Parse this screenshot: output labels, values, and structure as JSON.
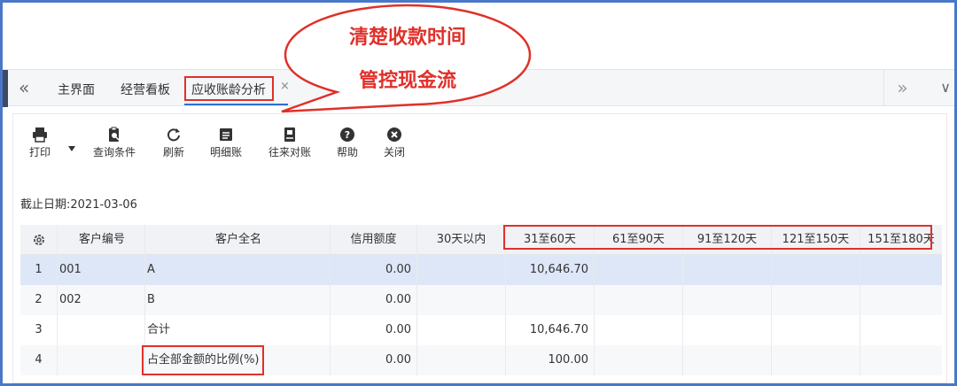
{
  "callout": {
    "line1": "清楚收款时间",
    "line2": "管控现金流"
  },
  "tabs": {
    "home": "主界面",
    "board": "经营看板",
    "active": "应收账龄分析",
    "close": "×"
  },
  "nav": {
    "back": "«",
    "forward": "»",
    "dropdown": "∨"
  },
  "toolbar": {
    "print": "打印",
    "query": "查询条件",
    "refresh": "刷新",
    "detail": "明细账",
    "reconcile": "往来对账",
    "help": "帮助",
    "close": "关闭"
  },
  "cutoff": "截止日期:2021-03-06",
  "table": {
    "headers": [
      "客户编号",
      "客户全名",
      "信用额度",
      "30天以内",
      "31至60天",
      "61至90天",
      "91至120天",
      "121至150天",
      "151至180天"
    ],
    "rows": [
      {
        "idx": "1",
        "code": "001",
        "name": "A",
        "credit": "0.00",
        "d30": "",
        "d60": "10,646.70"
      },
      {
        "idx": "2",
        "code": "002",
        "name": "B",
        "credit": "0.00",
        "d30": "",
        "d60": ""
      },
      {
        "idx": "3",
        "code": "",
        "name": "合计",
        "credit": "0.00",
        "d30": "",
        "d60": "10,646.70"
      },
      {
        "idx": "4",
        "code": "",
        "name": "占全部金额的比例(%)",
        "credit": "0.00",
        "d30": "",
        "d60": "100.00"
      }
    ]
  },
  "colors": {
    "accent": "#2f6fd2",
    "highlight": "#e0302a",
    "selected_row": "#dde7f7",
    "frame": "#4a78c8"
  }
}
